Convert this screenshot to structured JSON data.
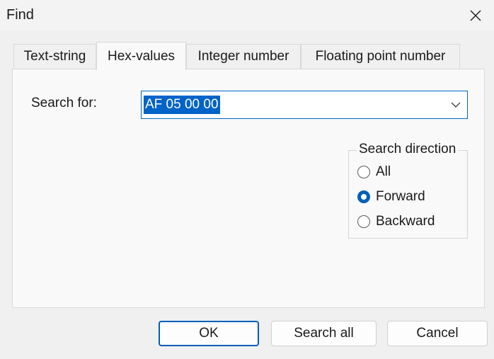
{
  "window": {
    "title": "Find",
    "close_icon": "close-icon"
  },
  "tabs": [
    {
      "label": "Text-string",
      "active": false
    },
    {
      "label": "Hex-values",
      "active": true
    },
    {
      "label": "Integer number",
      "active": false
    },
    {
      "label": "Floating point number",
      "active": false
    }
  ],
  "search": {
    "label": "Search for:",
    "value": "AF 05 00 00",
    "dropdown_icon": "chevron-down-icon"
  },
  "direction": {
    "legend": "Search direction",
    "options": [
      {
        "label": "All",
        "checked": false
      },
      {
        "label": "Forward",
        "checked": true
      },
      {
        "label": "Backward",
        "checked": false
      }
    ]
  },
  "buttons": {
    "ok": "OK",
    "search_all": "Search all",
    "cancel": "Cancel"
  },
  "colors": {
    "accent": "#005fb8",
    "selection": "#0063c7"
  }
}
